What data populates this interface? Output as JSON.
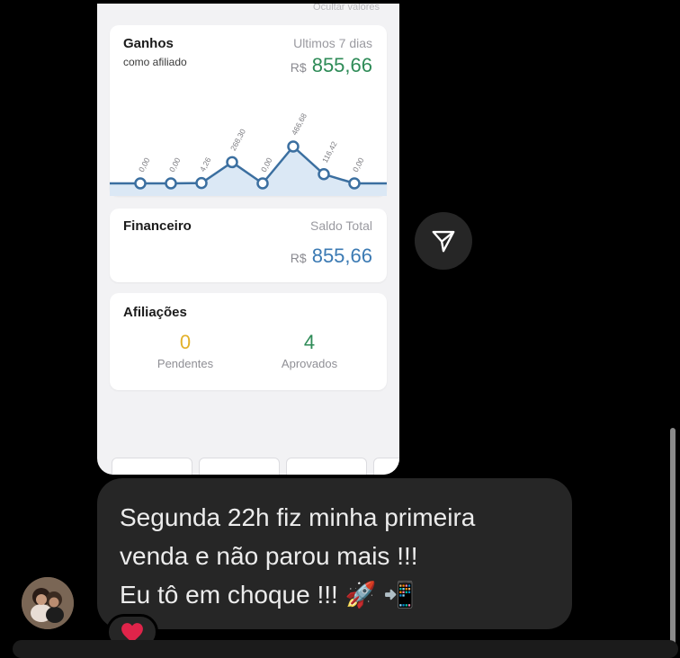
{
  "shared_screenshot": {
    "top_text": "Ocultar valores",
    "ganhos": {
      "title": "Ganhos",
      "subtitle": "como afiliado",
      "period": "Ultimos 7 dias",
      "currency": "R$",
      "amount": "855,66"
    },
    "financeiro": {
      "title": "Financeiro",
      "caption": "Saldo Total",
      "currency": "R$",
      "amount": "855,66"
    },
    "afiliacoes": {
      "title": "Afiliações",
      "pendentes_value": "0",
      "pendentes_label": "Pendentes",
      "aprovados_value": "4",
      "aprovados_label": "Aprovados"
    }
  },
  "chart_data": {
    "type": "line",
    "x": [
      1,
      2,
      3,
      4,
      5,
      6,
      7,
      8
    ],
    "values": [
      0.0,
      0.0,
      4.26,
      268.3,
      0.0,
      466.68,
      116.42,
      0.0
    ],
    "data_labels": [
      "0,00",
      "0,00",
      "4,26",
      "268,30",
      "0,00",
      "466,68",
      "116,42",
      "0,00"
    ],
    "colors": {
      "line": "#3b6fa0",
      "fill": "#dbe8f5"
    }
  },
  "message": {
    "lines": [
      "Segunda 22h fiz minha primeira",
      "venda e não parou mais !!!",
      "Eu tô em choque !!! 🚀 📲"
    ]
  },
  "reaction": {
    "icon": "heart-icon",
    "color": "#e0244a"
  },
  "share_button": {
    "icon": "send-icon"
  }
}
